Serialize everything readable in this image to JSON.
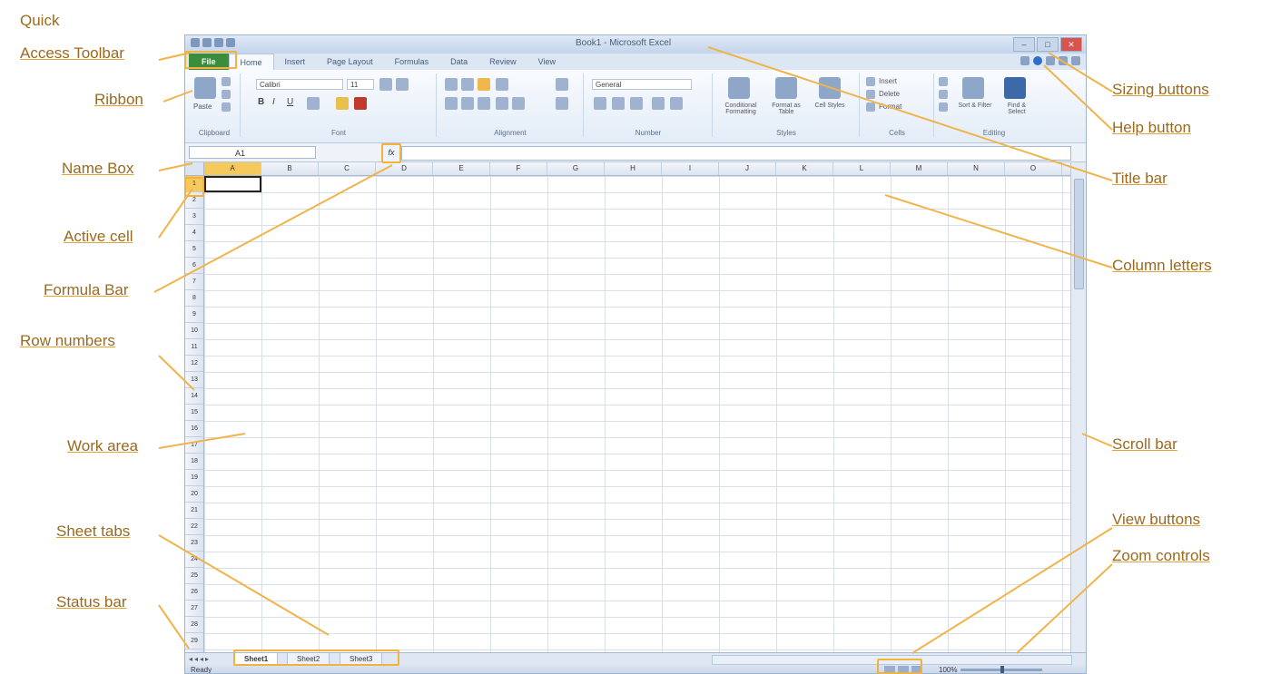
{
  "callouts": {
    "quick_access_line1": "Quick",
    "quick_access_line2": "Access Toolbar",
    "ribbon": "Ribbon",
    "name_box": "Name Box",
    "active_cell": "Active cell",
    "formula_bar": "Formula Bar",
    "row_numbers": "Row numbers",
    "work_area": "Work area",
    "sheet_tabs": "Sheet tabs",
    "status_bar": "Status bar",
    "sizing_buttons": "Sizing buttons",
    "help_button": "Help button",
    "title_bar": "Title bar",
    "column_letters": "Column letters",
    "scroll_bar": "Scroll bar",
    "view_buttons": "View buttons",
    "zoom_controls": "Zoom controls"
  },
  "window": {
    "title": "Book1 - Microsoft Excel",
    "file_tab": "File",
    "tabs": [
      "Home",
      "Insert",
      "Page Layout",
      "Formulas",
      "Data",
      "Review",
      "View"
    ],
    "sizing": [
      "–",
      "□",
      "✕"
    ]
  },
  "ribbon": {
    "font_name": "Calibri",
    "font_size": "11",
    "number_format": "General",
    "bold": "B",
    "italic": "I",
    "underline": "U",
    "groups": [
      "Clipboard",
      "Font",
      "Alignment",
      "Number",
      "Styles",
      "Cells",
      "Editing"
    ],
    "paste": "Paste",
    "conditional_formatting": "Conditional Formatting",
    "format_as_table": "Format as Table",
    "cell_styles": "Cell Styles",
    "insert": "Insert",
    "delete": "Delete",
    "format": "Format",
    "sort_filter": "Sort & Filter",
    "find_select": "Find & Select"
  },
  "formula_bar": {
    "name_box_value": "A1",
    "fx": "fx"
  },
  "columns": [
    "A",
    "B",
    "C",
    "D",
    "E",
    "F",
    "G",
    "H",
    "I",
    "J",
    "K",
    "L",
    "M",
    "N",
    "O"
  ],
  "rows": [
    "1",
    "2",
    "3",
    "4",
    "5",
    "6",
    "7",
    "8",
    "9",
    "10",
    "11",
    "12",
    "13",
    "14",
    "15",
    "16",
    "17",
    "18",
    "19",
    "20",
    "21",
    "22",
    "23",
    "24",
    "25",
    "26",
    "27",
    "28",
    "29"
  ],
  "sheets": [
    "Sheet1",
    "Sheet2",
    "Sheet3"
  ],
  "status": {
    "ready": "Ready",
    "zoom": "100%"
  }
}
